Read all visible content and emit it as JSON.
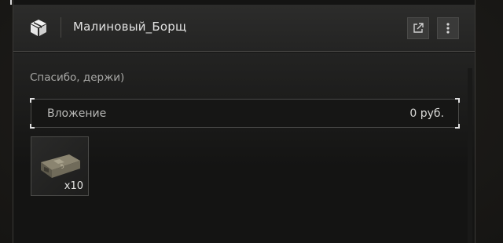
{
  "header": {
    "title": "Малиновый_Борщ",
    "app_icon": "package-box-icon",
    "open_icon": "external-link-icon",
    "menu_icon": "more-vertical-icon"
  },
  "message": {
    "text": "Спасибо, держи)"
  },
  "attachment": {
    "label": "Вложение",
    "value": "0 руб."
  },
  "items": [
    {
      "icon": "ammo-crate-icon",
      "count": "x10"
    }
  ],
  "colors": {
    "panel_bg": "#141413",
    "header_bg": "#2c2c2b",
    "text_primary": "#e2e2e2",
    "text_muted": "#a8a8a6"
  }
}
